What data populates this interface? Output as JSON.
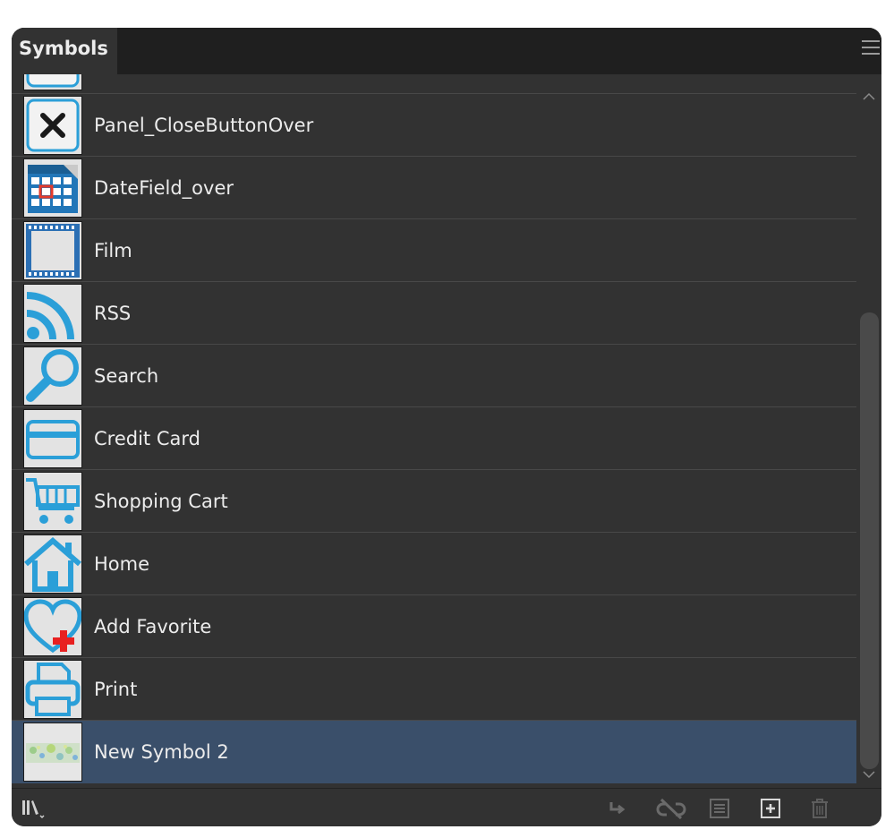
{
  "panel": {
    "tab_title": "Symbols",
    "menu_icon": "panel-menu-icon"
  },
  "symbols": [
    {
      "name": "Panel_CloseButtonOver",
      "icon": "close-x-icon"
    },
    {
      "name": "DateField_over",
      "icon": "calendar-icon"
    },
    {
      "name": "Film",
      "icon": "film-icon"
    },
    {
      "name": "RSS",
      "icon": "rss-icon"
    },
    {
      "name": "Search",
      "icon": "search-icon"
    },
    {
      "name": "Credit Card",
      "icon": "credit-card-icon"
    },
    {
      "name": "Shopping Cart",
      "icon": "shopping-cart-icon"
    },
    {
      "name": "Home",
      "icon": "home-icon"
    },
    {
      "name": "Add Favorite",
      "icon": "add-favorite-icon"
    },
    {
      "name": "Print",
      "icon": "printer-icon"
    },
    {
      "name": "New Symbol 2",
      "icon": "pattern-thumbnail",
      "selected": true
    }
  ],
  "footer": {
    "buttons": [
      "symbol-libraries-icon",
      "place-symbol-icon",
      "break-link-icon",
      "symbol-options-icon",
      "new-symbol-icon",
      "delete-symbol-icon"
    ]
  },
  "colors": {
    "panel_bg": "#323232",
    "header_bg": "#1f1f1f",
    "selected_row": "#3a4f6a",
    "icon_blue": "#2b9fd8",
    "text": "#ececec"
  }
}
